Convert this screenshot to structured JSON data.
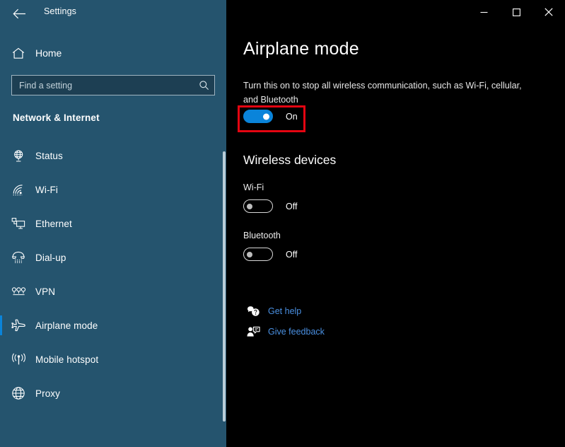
{
  "window": {
    "app_title": "Settings",
    "back_icon": "back-arrow-icon",
    "controls": {
      "minimize": "minimize-icon",
      "maximize": "maximize-icon",
      "close": "close-icon"
    }
  },
  "sidebar": {
    "home": {
      "label": "Home",
      "icon": "home-icon"
    },
    "search": {
      "placeholder": "Find a setting",
      "value": "",
      "icon": "search-icon"
    },
    "category": "Network & Internet",
    "items": [
      {
        "label": "Status",
        "icon": "globe-monitor-icon",
        "selected": false
      },
      {
        "label": "Wi-Fi",
        "icon": "wifi-icon",
        "selected": false
      },
      {
        "label": "Ethernet",
        "icon": "ethernet-icon",
        "selected": false
      },
      {
        "label": "Dial-up",
        "icon": "dialup-phone-icon",
        "selected": false
      },
      {
        "label": "VPN",
        "icon": "vpn-icon",
        "selected": false
      },
      {
        "label": "Airplane mode",
        "icon": "airplane-icon",
        "selected": true
      },
      {
        "label": "Mobile hotspot",
        "icon": "hotspot-icon",
        "selected": false
      },
      {
        "label": "Proxy",
        "icon": "globe-icon",
        "selected": false
      }
    ]
  },
  "main": {
    "title": "Airplane mode",
    "description": "Turn this on to stop all wireless communication, such as Wi-Fi, cellular, and Bluetooth",
    "airplane_toggle": {
      "state": "On",
      "on": true
    },
    "wireless_heading": "Wireless devices",
    "devices": [
      {
        "label": "Wi-Fi",
        "state": "Off",
        "on": false
      },
      {
        "label": "Bluetooth",
        "state": "Off",
        "on": false
      }
    ],
    "links": [
      {
        "label": "Get help",
        "icon": "help-bubble-icon"
      },
      {
        "label": "Give feedback",
        "icon": "feedback-person-icon"
      }
    ]
  },
  "colors": {
    "accent": "#0a84da",
    "sidebar_bg": "#25546e",
    "content_bg": "#000000",
    "highlight_box": "#e40511",
    "link": "#4a90e2"
  }
}
